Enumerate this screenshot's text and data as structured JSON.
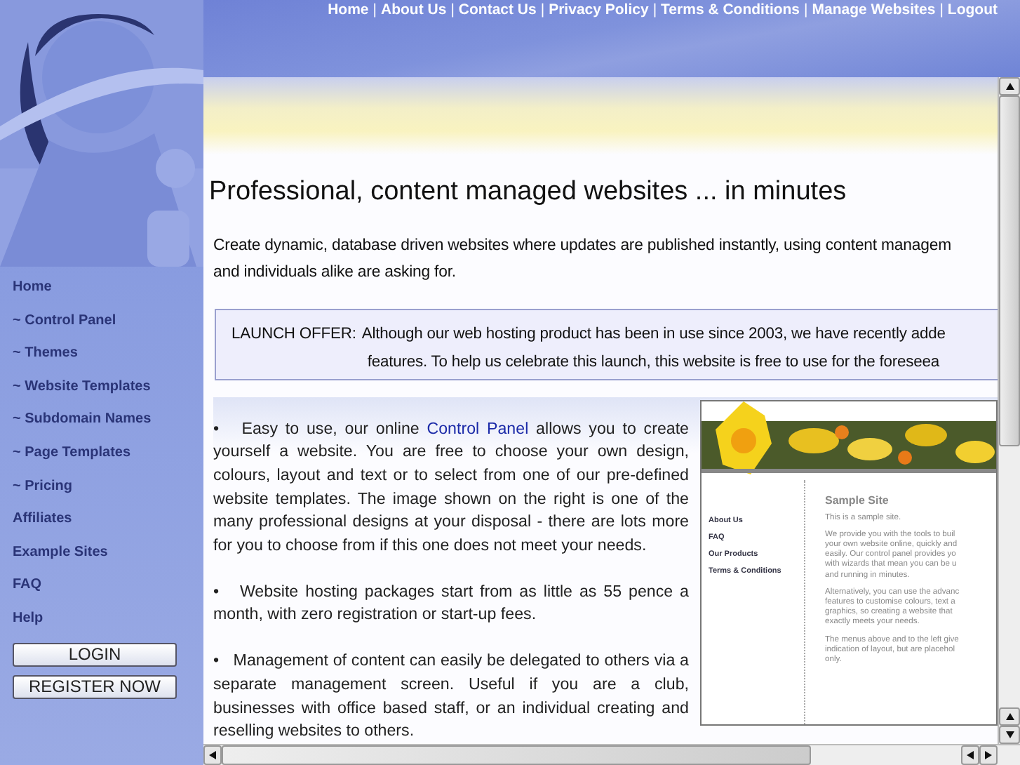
{
  "top_nav": [
    {
      "label": "Home"
    },
    {
      "label": "About Us"
    },
    {
      "label": "Contact Us"
    },
    {
      "label": "Privacy Policy"
    },
    {
      "label": "Terms & Conditions"
    },
    {
      "label": "Manage Websites"
    },
    {
      "label": "Logout"
    }
  ],
  "nav_separator": "|",
  "sidebar": {
    "items": [
      {
        "label": "Home"
      },
      {
        "label": "~ Control Panel"
      },
      {
        "label": "~ Themes"
      },
      {
        "label": "~ Website Templates"
      },
      {
        "label": "~ Subdomain Names"
      },
      {
        "label": "~ Page Templates"
      },
      {
        "label": "~ Pricing"
      },
      {
        "label": "Affiliates"
      },
      {
        "label": "Example Sites"
      },
      {
        "label": "FAQ"
      },
      {
        "label": "Help"
      }
    ],
    "buttons": [
      "LOGIN",
      "REGISTER NOW"
    ]
  },
  "content": {
    "title": "Professional, content managed websites ... in minutes",
    "intro": "Create dynamic, database driven websites where updates are published instantly, using content managem\nand individuals alike are asking for.",
    "launch_offer": {
      "label": "LAUNCH OFFER:",
      "line_1": "Although our web hosting product has been in use since 2003, we have recently adde",
      "line_2": "features. To help us celebrate this launch, this website is free to use for the foreseea"
    },
    "features": [
      {
        "bullet": "•",
        "before": "Easy to use, our online ",
        "link": "Control Panel",
        "after": " allows you to create yourself a website. You are free to choose your own design, colours, layout and text or to select from one of our pre-defined website templates. The image shown on the right is one of the many professional designs at your disposal - there are lots more for you to choose from if this one does not meet your needs."
      },
      {
        "bullet": "•",
        "before": "Website hosting packages start from as little as 55 pence a month, with zero registration or start-up fees."
      },
      {
        "bullet": "•",
        "before": "Management of content can easily be delegated to others via a separate management screen. Useful if you are a club, businesses with office based staff, or an individual creating and reselling websites to others."
      }
    ],
    "sample_site": {
      "nav": [
        "About Us",
        "FAQ",
        "Our Products",
        "Terms & Conditions"
      ],
      "title": "Sample Site",
      "paragraphs": [
        "This is a sample site.",
        "We provide you with the tools to buil\nyour own website online, quickly and\neasily. Our control panel provides yo\nwith wizards that mean you can be u\nand running in minutes.",
        "Alternatively, you can use the advanc\nfeatures to customise colours, text a\ngraphics, so creating a website that\nexactly meets your needs.",
        "The menus above and to the left give\nindication of layout, but are placehol\nonly."
      ]
    }
  }
}
